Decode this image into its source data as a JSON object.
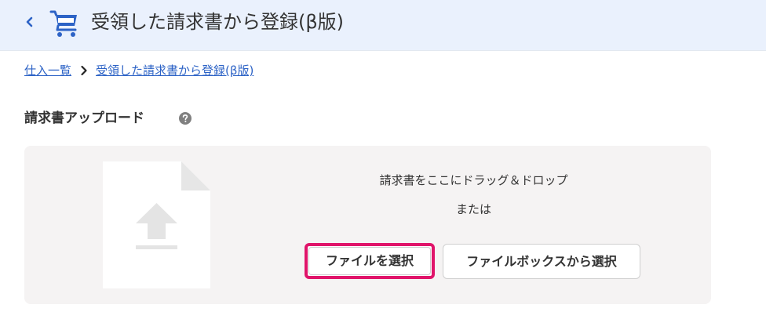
{
  "header": {
    "title": "受領した請求書から登録(β版)",
    "accent_color": "#2d63c6"
  },
  "breadcrumb": {
    "items": [
      "仕入一覧",
      "受領した請求書から登録(β版)"
    ]
  },
  "upload": {
    "section_title": "請求書アップロード",
    "drop_text": "請求書をここにドラッグ＆ドロップ",
    "or_text": "または",
    "select_file_label": "ファイルを選択",
    "select_from_filebox_label": "ファイルボックスから選択",
    "highlight_color": "#e0146a"
  },
  "icons": {
    "back": "chevron-left-icon",
    "cart": "shopping-cart-icon",
    "help": "question-circle-icon",
    "breadcrumb_separator": "chevron-right-icon",
    "file_upload": "file-upload-icon"
  }
}
